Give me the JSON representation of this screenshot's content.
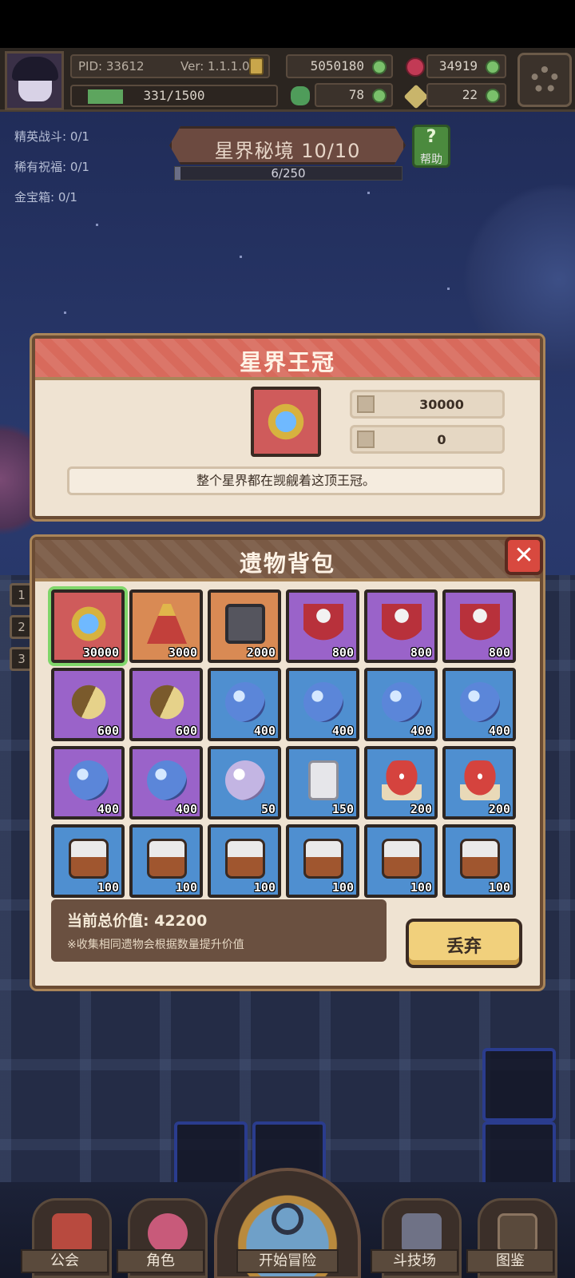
{
  "topbar": {
    "pid": "PID: 33612",
    "version": "Ver: 1.1.1.0",
    "gold": "5050180",
    "gems": "34919",
    "exp_text": "331/1500",
    "exp_progress": 0.22,
    "clover": "78",
    "keys": "22",
    "settings_icon": "gear-icon"
  },
  "quests": [
    "精英战斗: 0/1",
    "稀有祝福: 0/1",
    "金宝箱: 0/1"
  ],
  "stage": {
    "title": "星界秘境 10/10",
    "progress_text": "6/250",
    "progress": 0.024,
    "help_label": "帮助",
    "help_glyph": "?"
  },
  "relic_detail": {
    "title": "星界王冠",
    "icon": "crown-icon",
    "value": "30000",
    "upgrade": "0",
    "description": "整个星界都在觊觎着这顶王冠。"
  },
  "bag": {
    "title": "遗物背包",
    "close_glyph": "✕",
    "items": [
      {
        "icon": "crown-icon",
        "rarity": "red",
        "value": "30000",
        "selected": true
      },
      {
        "icon": "statue-icon",
        "rarity": "orange",
        "value": "3000"
      },
      {
        "icon": "box-icon",
        "rarity": "orange",
        "value": "2000"
      },
      {
        "icon": "cloak-icon",
        "rarity": "purple",
        "value": "800"
      },
      {
        "icon": "cloak-icon",
        "rarity": "purple",
        "value": "800"
      },
      {
        "icon": "cloak-icon",
        "rarity": "purple",
        "value": "800"
      },
      {
        "icon": "telescope-icon",
        "rarity": "purple",
        "value": "600"
      },
      {
        "icon": "telescope-icon",
        "rarity": "purple",
        "value": "600"
      },
      {
        "icon": "orb-icon",
        "rarity": "blue",
        "value": "400"
      },
      {
        "icon": "orb-icon",
        "rarity": "blue",
        "value": "400"
      },
      {
        "icon": "orb-icon",
        "rarity": "blue",
        "value": "400"
      },
      {
        "icon": "orb-icon",
        "rarity": "blue",
        "value": "400"
      },
      {
        "icon": "orb-icon",
        "rarity": "purple",
        "value": "400"
      },
      {
        "icon": "orb-icon",
        "rarity": "purple",
        "value": "400"
      },
      {
        "icon": "pearl-icon",
        "rarity": "blue",
        "value": "50"
      },
      {
        "icon": "tablet-icon",
        "rarity": "blue",
        "value": "150"
      },
      {
        "icon": "mushroom-icon",
        "rarity": "blue",
        "value": "200"
      },
      {
        "icon": "mushroom-icon",
        "rarity": "blue",
        "value": "200"
      },
      {
        "icon": "drum-icon",
        "rarity": "blue",
        "value": "100"
      },
      {
        "icon": "drum-icon",
        "rarity": "blue",
        "value": "100"
      },
      {
        "icon": "drum-icon",
        "rarity": "blue",
        "value": "100"
      },
      {
        "icon": "drum-icon",
        "rarity": "blue",
        "value": "100"
      },
      {
        "icon": "drum-icon",
        "rarity": "blue",
        "value": "100"
      },
      {
        "icon": "drum-icon",
        "rarity": "blue",
        "value": "100"
      }
    ],
    "total_label": "当前总价值: 42200",
    "note": "※收集相同遗物会根据数量提升价值",
    "discard_label": "丢弃"
  },
  "side_tabs": [
    "1",
    "2",
    "3"
  ],
  "bottom_nav": {
    "guild": "公会",
    "character": "角色",
    "start": "开始冒险",
    "arena": "斗技场",
    "codex": "图鉴"
  },
  "colors": {
    "red": "#cf5b5b",
    "orange": "#d98a54",
    "purple": "#9a63c9",
    "blue": "#4f8fd0",
    "header_red": "#d86a5c",
    "header_brown": "#7a5a45",
    "discard": "#f1d07c"
  }
}
